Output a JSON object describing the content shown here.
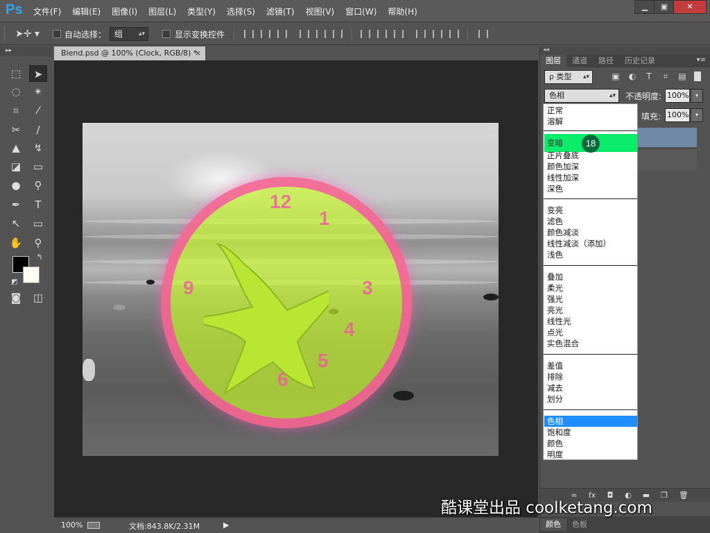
{
  "app": {
    "logo": "Ps"
  },
  "menu": [
    "文件(F)",
    "编辑(E)",
    "图像(I)",
    "图层(L)",
    "类型(Y)",
    "选择(S)",
    "滤镜(T)",
    "视图(V)",
    "窗口(W)",
    "帮助(H)"
  ],
  "window_controls": {
    "minimize": "▁",
    "maximize": "▣",
    "close": "✕"
  },
  "options": {
    "auto_select_label": "自动选择：",
    "auto_select_target": "组",
    "show_transform_label": "显示变换控件"
  },
  "document": {
    "tab_title": "Blend.psd @ 100% (Clock, RGB/8) *",
    "close_glyph": "×"
  },
  "canvas": {
    "clock_numbers": [
      "12",
      "3",
      "6",
      "1",
      "4",
      "5",
      "9"
    ]
  },
  "status": {
    "zoom": "100%",
    "doc_info": "文档:843.8K/2.31M",
    "arrow": "▶"
  },
  "panel": {
    "collapse": "◂◂",
    "tabs": [
      "图层",
      "通道",
      "路径",
      "历史记录"
    ],
    "menu": "▾≡",
    "filter_label": "ρ 类型",
    "blend_mode": "色相",
    "opacity_label": "不透明度:",
    "opacity_value": "100%",
    "fill_label": "填充:",
    "fill_value": "100%",
    "footer_icons": [
      "link-icon",
      "fx-icon",
      "mask-icon",
      "adjustment-icon",
      "folder-icon",
      "new-layer-icon",
      "trash-icon"
    ],
    "bottom_tabs": [
      "颜色",
      "色板"
    ]
  },
  "blend_modes": [
    {
      "label": "正常",
      "group": 1
    },
    {
      "label": "溶解",
      "group": 1
    },
    {
      "label": "变暗",
      "group": 2,
      "highlight": true
    },
    {
      "label": "正片叠底",
      "group": 2
    },
    {
      "label": "颜色加深",
      "group": 2
    },
    {
      "label": "线性加深",
      "group": 2
    },
    {
      "label": "深色",
      "group": 2
    },
    {
      "label": "变亮",
      "group": 3
    },
    {
      "label": "滤色",
      "group": 3
    },
    {
      "label": "颜色减淡",
      "group": 3
    },
    {
      "label": "线性减淡（添加）",
      "group": 3
    },
    {
      "label": "浅色",
      "group": 3
    },
    {
      "label": "叠加",
      "group": 4
    },
    {
      "label": "柔光",
      "group": 4
    },
    {
      "label": "强光",
      "group": 4
    },
    {
      "label": "亮光",
      "group": 4
    },
    {
      "label": "线性光",
      "group": 4
    },
    {
      "label": "点光",
      "group": 4
    },
    {
      "label": "实色混合",
      "group": 4
    },
    {
      "label": "差值",
      "group": 5
    },
    {
      "label": "排除",
      "group": 5
    },
    {
      "label": "减去",
      "group": 5
    },
    {
      "label": "划分",
      "group": 5
    },
    {
      "label": "色相",
      "group": 6,
      "selected": true
    },
    {
      "label": "饱和度",
      "group": 6
    },
    {
      "label": "颜色",
      "group": 6
    },
    {
      "label": "明度",
      "group": 6
    }
  ],
  "step_badge": "18",
  "watermark": "酷课堂出品 coolketang.com",
  "colors": {
    "ps_blue": "#35a3ee",
    "hover_green": "#0bed6a",
    "selected_blue": "#1f8fff",
    "clock_face": "#cdff28",
    "clock_ring": "#ff46aa"
  }
}
